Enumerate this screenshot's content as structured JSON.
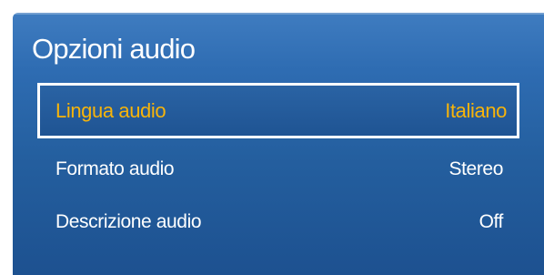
{
  "menu": {
    "title": "Opzioni audio",
    "items": [
      {
        "label": "Lingua audio",
        "value": "Italiano",
        "selected": true
      },
      {
        "label": "Formato audio",
        "value": "Stereo",
        "selected": false
      },
      {
        "label": "Descrizione audio",
        "value": "Off",
        "selected": false
      }
    ]
  },
  "colors": {
    "panel_top": "#3f7cc0",
    "panel_bottom": "#1d5190",
    "highlight_text": "#f7b40a",
    "text": "#ffffff",
    "focus_border": "#ffffff"
  }
}
